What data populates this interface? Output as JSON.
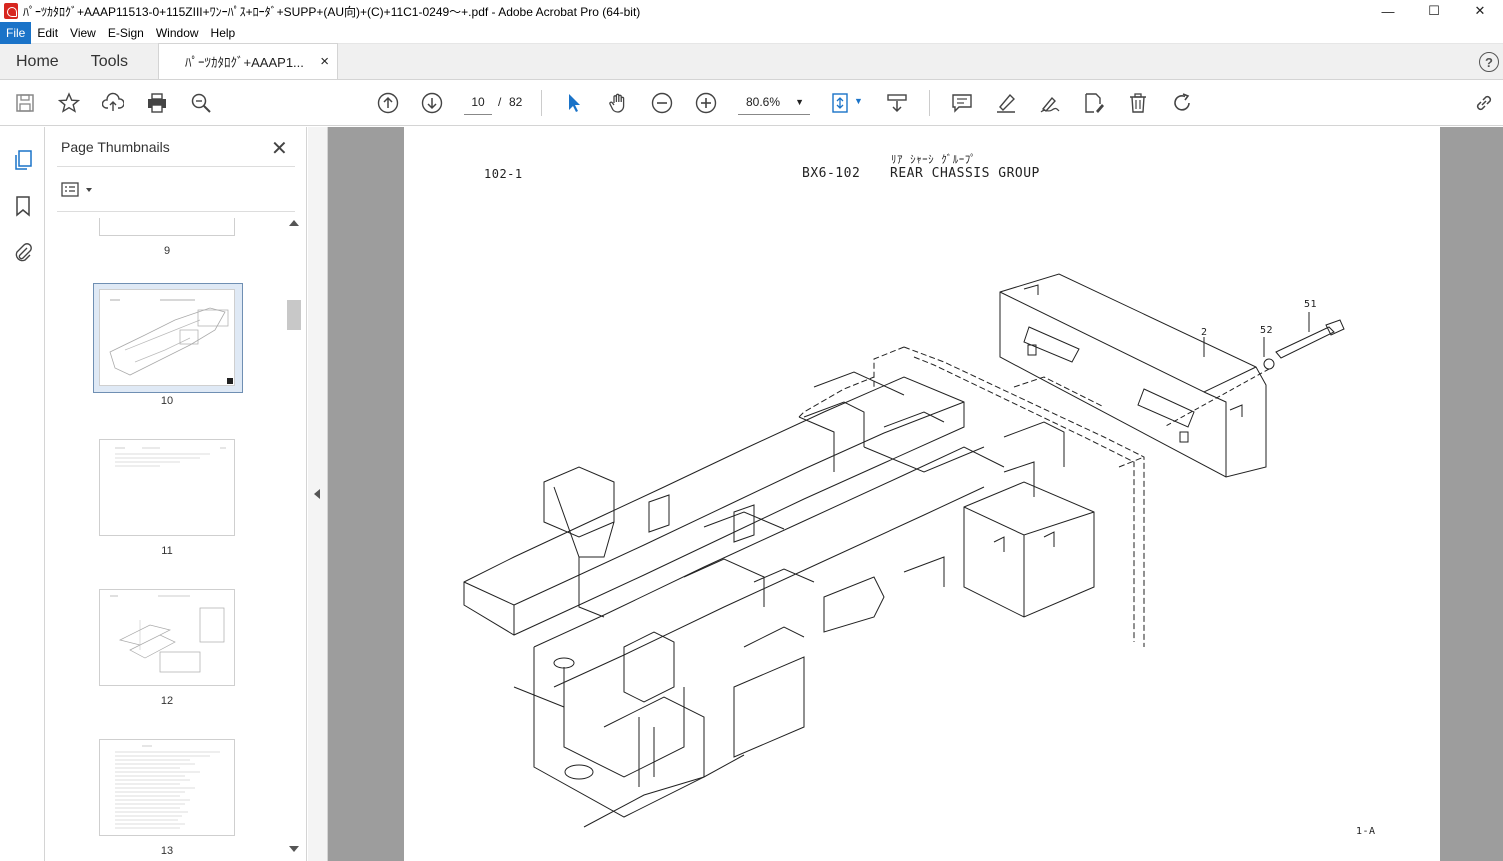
{
  "window": {
    "title": "ﾊﾟｰﾂｶﾀﾛｸﾞ+AAAP11513-0+115ZIII+ﾜﾝｰﾊﾟｽ+ﾛｰﾀﾞ+SUPP+(AU向)+(C)+11C1-0249〜+.pdf - Adobe Acrobat Pro (64-bit)",
    "minimize": "—",
    "maximize": "☐",
    "close": "✕"
  },
  "menu": {
    "items": [
      "File",
      "Edit",
      "View",
      "E-Sign",
      "Window",
      "Help"
    ]
  },
  "tabs": {
    "home": "Home",
    "tools": "Tools",
    "doc": "ﾊﾟｰﾂｶﾀﾛｸﾞ+AAAP1...",
    "doc_close": "×",
    "help": "?"
  },
  "toolbar": {
    "current_page": "10",
    "page_sep": "/",
    "total_pages": "82",
    "zoom": "80.6%",
    "zoom_caret": "▼"
  },
  "icons": {
    "save": "save-icon",
    "star": "star-icon",
    "upload": "upload-icon",
    "print": "print-icon",
    "zoom_search": "zoom-search-icon",
    "prev": "prev-page-icon",
    "next": "next-page-icon",
    "select": "select-arrow-icon",
    "hand": "hand-icon",
    "zoom_out": "zoom-out-icon",
    "zoom_in": "zoom-in-icon",
    "fit": "fit-page-icon",
    "scroll": "scroll-mode-icon",
    "comment": "comment-icon",
    "highlight": "highlight-icon",
    "sign": "sign-icon",
    "edit": "edit-icon",
    "delete": "delete-icon",
    "redo": "redo-icon",
    "share": "share-link-icon"
  },
  "panel": {
    "title": "Page Thumbnails",
    "close": "✕",
    "thumbnails": [
      {
        "label": "9"
      },
      {
        "label": "10",
        "selected": true
      },
      {
        "label": "11"
      },
      {
        "label": "12"
      },
      {
        "label": "13"
      }
    ]
  },
  "page_content": {
    "ref_left": "102-1",
    "ref_code": "BX6-102",
    "title_kana": "ﾘｱ ｼｬｰｼ ｸﾞﾙｰﾌﾟ",
    "title": "REAR CHASSIS GROUP",
    "callout_2": "2",
    "callout_52": "52",
    "callout_51": "51",
    "footer": "1-A"
  }
}
